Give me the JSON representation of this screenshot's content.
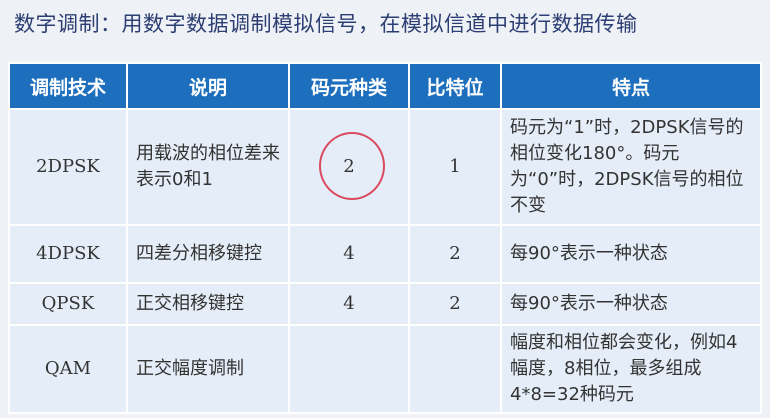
{
  "heading": "数字调制：用数字数据调制模拟信号，在模拟信道中进行数据传输",
  "table": {
    "headers": [
      "调制技术",
      "说明",
      "码元种类",
      "比特位",
      "特点"
    ],
    "rows": [
      {
        "tech": "2DPSK",
        "desc": "用载波的相位差来表示0和1",
        "symbols": "2",
        "bits": "1",
        "feature": "码元为“1”时，2DPSK信号的相位变化180°。码元为“0”时，2DPSK信号的相位不变"
      },
      {
        "tech": "4DPSK",
        "desc": "四差分相移键控",
        "symbols": "4",
        "bits": "2",
        "feature": "每90°表示一种状态"
      },
      {
        "tech": "QPSK",
        "desc": "正交相移键控",
        "symbols": "4",
        "bits": "2",
        "feature": "每90°表示一种状态"
      },
      {
        "tech": "QAM",
        "desc": "正交幅度调制",
        "symbols": "",
        "bits": "",
        "feature": "幅度和相位都会变化，例如4幅度，8相位，最多组成4*8=32种码元"
      }
    ]
  }
}
